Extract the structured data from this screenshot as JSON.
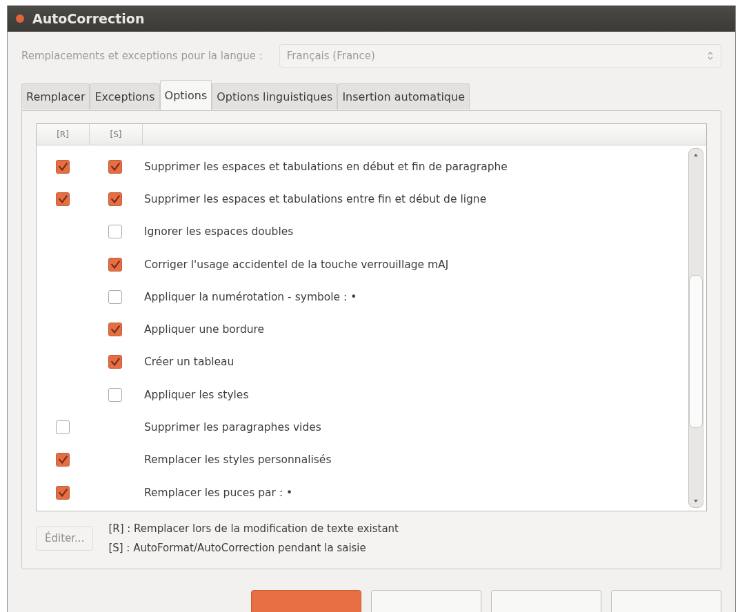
{
  "window": {
    "title": "AutoCorrection"
  },
  "language": {
    "label": "Remplacements et exceptions pour la langue :",
    "value": "Français (France)"
  },
  "tabs": [
    {
      "label": "Remplacer",
      "selected": false
    },
    {
      "label": "Exceptions",
      "selected": false
    },
    {
      "label": "Options",
      "selected": true
    },
    {
      "label": "Options linguistiques",
      "selected": false
    },
    {
      "label": "Insertion automatique",
      "selected": false
    }
  ],
  "options": {
    "columns": [
      "[R]",
      "[S]"
    ],
    "rows": [
      {
        "label": "Supprimer les espaces et tabulations en début et fin de paragraphe",
        "r": {
          "checked": true
        },
        "s": {
          "checked": true
        }
      },
      {
        "label": "Supprimer les espaces et tabulations entre fin et début de ligne",
        "r": {
          "checked": true
        },
        "s": {
          "checked": true
        }
      },
      {
        "label": "Ignorer les espaces doubles",
        "s": {
          "checked": false
        }
      },
      {
        "label": "Corriger l'usage accidentel de la touche verrouillage mAJ",
        "s": {
          "checked": true
        }
      },
      {
        "label": "Appliquer la numérotation - symbole : •",
        "s": {
          "checked": false
        }
      },
      {
        "label": "Appliquer une bordure",
        "s": {
          "checked": true
        }
      },
      {
        "label": "Créer un tableau",
        "s": {
          "checked": true
        }
      },
      {
        "label": "Appliquer les styles",
        "s": {
          "checked": false
        }
      },
      {
        "label": "Supprimer les paragraphes vides",
        "r": {
          "checked": false
        }
      },
      {
        "label": "Remplacer les styles personnalisés",
        "r": {
          "checked": true
        }
      },
      {
        "label": "Remplacer les puces par : •",
        "r": {
          "checked": true
        }
      }
    ]
  },
  "edit_button": {
    "label": "Éditer...",
    "disabled": true
  },
  "legend": [
    "[R] : Remplacer lors de la modification de texte existant",
    "[S] : AutoFormat/AutoCorrection pendant la saisie"
  ],
  "buttons": [
    {
      "default": true
    },
    {
      "default": false
    },
    {
      "default": false
    },
    {
      "default": false
    }
  ]
}
